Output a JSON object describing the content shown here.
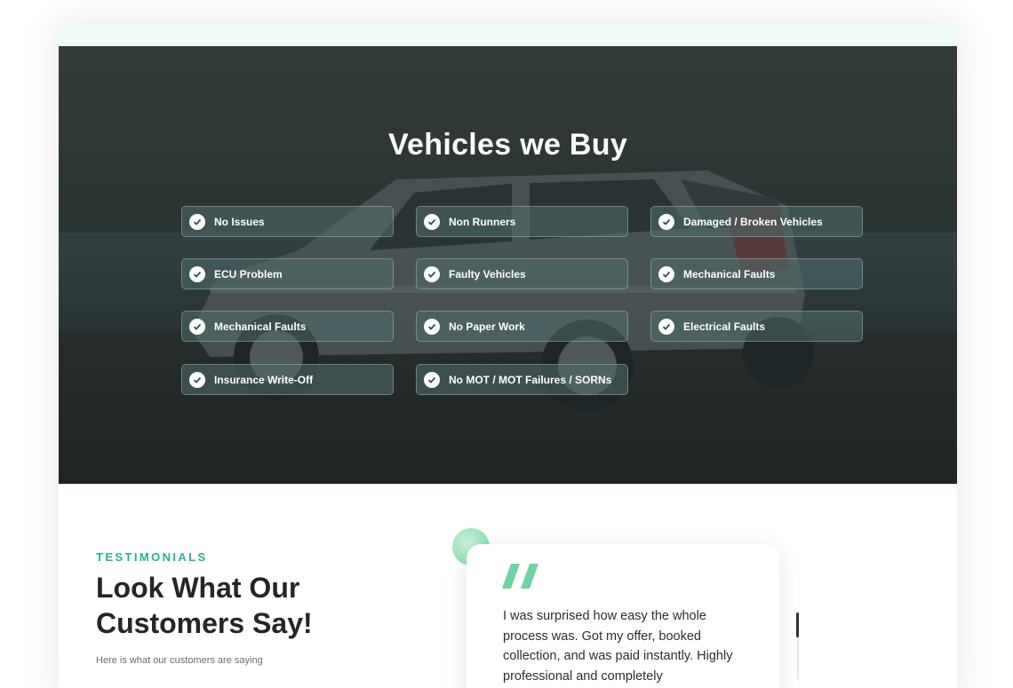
{
  "hero": {
    "title": "Vehicles we Buy",
    "chips": [
      {
        "label": "No Issues"
      },
      {
        "label": "Non Runners"
      },
      {
        "label": "Damaged / Broken Vehicles"
      },
      {
        "label": "ECU Problem"
      },
      {
        "label": "Faulty Vehicles"
      },
      {
        "label": "Mechanical Faults"
      },
      {
        "label": "Mechanical Faults"
      },
      {
        "label": "No Paper Work"
      },
      {
        "label": "Electrical Faults"
      },
      {
        "label": "Insurance Write-Off"
      },
      {
        "label": "No MOT / MOT Failures / SORNs"
      }
    ],
    "icon": "check-circle-icon"
  },
  "testimonials": {
    "eyebrow": "TESTIMONIALS",
    "heading": "Look What Our Customers Say!",
    "subtext": "Here is what our customers are saying",
    "quote_icon": "quote-icon",
    "quote": "I was surprised how easy the whole process was. Got my offer, booked collection, and was paid instantly. Highly professional and completely"
  },
  "colors": {
    "accent": "#2bb08c",
    "quote_green": "#6fd3a6",
    "heading_text": "#22262b",
    "topstrip": "#f0fbf9"
  }
}
